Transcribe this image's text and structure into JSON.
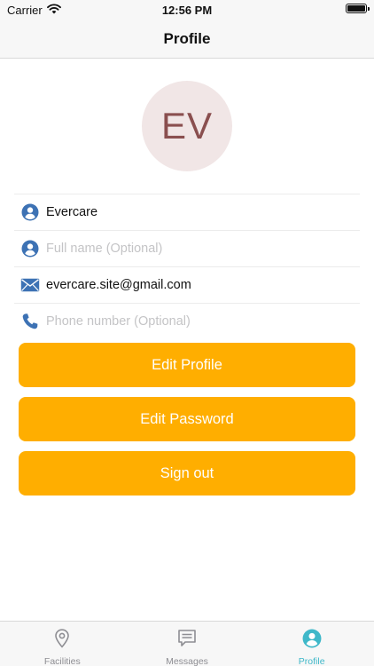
{
  "status_bar": {
    "carrier": "Carrier",
    "time": "12:56 PM"
  },
  "nav": {
    "title": "Profile"
  },
  "avatar": {
    "initials": "EV"
  },
  "fields": {
    "username": {
      "value": "Evercare",
      "placeholder": ""
    },
    "full_name": {
      "value": "",
      "placeholder": "Full name (Optional)"
    },
    "email": {
      "value": "evercare.site@gmail.com",
      "placeholder": ""
    },
    "phone": {
      "value": "",
      "placeholder": "Phone number (Optional)"
    }
  },
  "buttons": {
    "edit_profile": "Edit Profile",
    "edit_password": "Edit Password",
    "sign_out": "Sign out"
  },
  "tabs": [
    {
      "label": "Facilities",
      "icon": "location-pin-icon",
      "active": false
    },
    {
      "label": "Messages",
      "icon": "message-icon",
      "active": false
    },
    {
      "label": "Profile",
      "icon": "user-icon",
      "active": true
    }
  ],
  "colors": {
    "accent": "#ffae00",
    "icon_blue": "#3d72b4",
    "tab_active": "#3fb8c9",
    "tab_inactive": "#8e8e93"
  }
}
